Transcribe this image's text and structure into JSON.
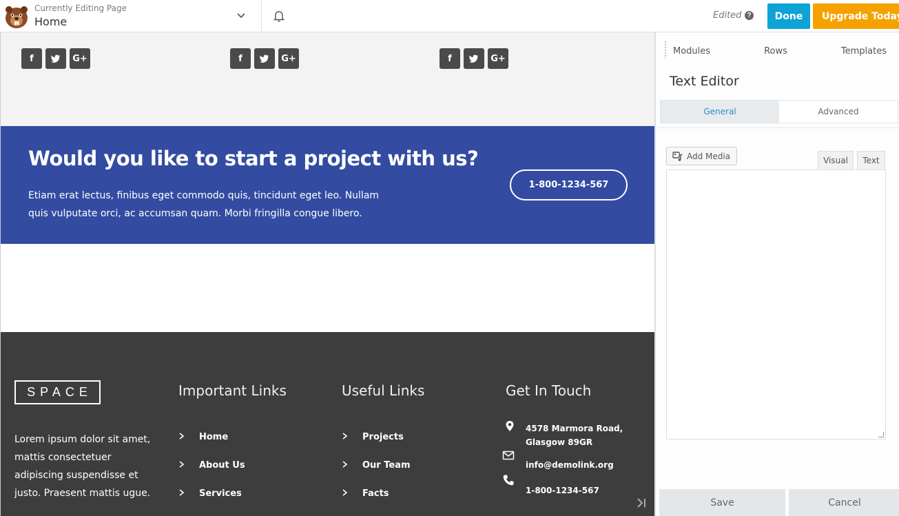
{
  "topbar": {
    "eyebrow": "Currently Editing Page",
    "current_page": "Home",
    "edited_label": "Edited",
    "help_glyph": "?",
    "done_label": "Done",
    "upgrade_label": "Upgrade Today",
    "colors": {
      "done": "#0ea3d6",
      "upgrade": "#f5a200"
    }
  },
  "social_groups": [
    {
      "icons": [
        "f",
        "t",
        "G+"
      ]
    },
    {
      "icons": [
        "f",
        "t",
        "G+"
      ]
    },
    {
      "icons": [
        "f",
        "t",
        "G+"
      ]
    }
  ],
  "cta": {
    "heading": "Would you like to start a project with us?",
    "body": "Etiam erat lectus, finibus eget commodo quis, tincidunt eget leo. Nullam quis vulputate orci, ac accumsan quam. Morbi fringilla congue libero.",
    "button_label": "1-800-1234-567",
    "background": "#334ca1"
  },
  "footer": {
    "logo_text": "SPACE",
    "about_text": "Lorem ipsum dolor sit amet, mattis consectetuer adipiscing suspendisse et justo. Praesent mattis ugue.",
    "important_links": {
      "title": "Important Links",
      "items": [
        "Home",
        "About Us",
        "Services"
      ]
    },
    "useful_links": {
      "title": "Useful Links",
      "items": [
        "Projects",
        "Our Team",
        "Facts"
      ]
    },
    "contact": {
      "title": "Get In Touch",
      "address_line1": "4578 Marmora Road,",
      "address_line2": "Glasgow 89GR",
      "email": "info@demolink.org",
      "phone": "1-800-1234-567"
    }
  },
  "panel": {
    "tabs": [
      "Modules",
      "Rows",
      "Templates"
    ],
    "title": "Text Editor",
    "subtabs": {
      "general": "General",
      "advanced": "Advanced"
    },
    "add_media_label": "Add Media",
    "editor_tabs": {
      "visual": "Visual",
      "text": "Text"
    },
    "save_label": "Save",
    "cancel_label": "Cancel"
  }
}
